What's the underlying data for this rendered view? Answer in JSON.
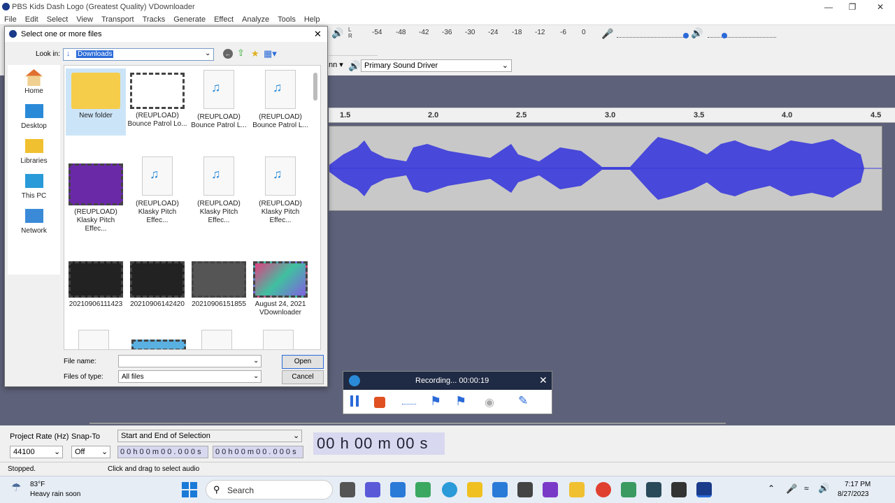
{
  "window": {
    "title": "PBS Kids Dash Logo (Greatest Quality) VDownloader"
  },
  "menu": [
    "File",
    "Edit",
    "Select",
    "View",
    "Transport",
    "Tracks",
    "Generate",
    "Effect",
    "Analyze",
    "Tools",
    "Help"
  ],
  "meter": {
    "ticks": [
      "-54",
      "-48",
      "-42",
      "-36",
      "-30",
      "-24",
      "-18",
      "-12",
      "-6",
      "0"
    ],
    "lr": "L\nR"
  },
  "device": {
    "host_partial": "nn",
    "output": "Primary Sound Driver"
  },
  "ruler": {
    "ticks": [
      "1.5",
      "2.0",
      "2.5",
      "3.0",
      "3.5",
      "4.0",
      "4.5"
    ]
  },
  "dialog": {
    "title": "Select one or more files",
    "look_in_label": "Look in:",
    "look_in_value": "Downloads",
    "places": [
      "Home",
      "Desktop",
      "Libraries",
      "This PC",
      "Network"
    ],
    "files": [
      {
        "line1": "New folder",
        "line2": "",
        "kind": "folder"
      },
      {
        "line1": "(REUPLOAD)",
        "line2": "Bounce Patrol Lo...",
        "kind": "video"
      },
      {
        "line1": "(REUPLOAD)",
        "line2": "Bounce Patrol L...",
        "kind": "media"
      },
      {
        "line1": "(REUPLOAD)",
        "line2": "Bounce Patrol L...",
        "kind": "media"
      },
      {
        "line1": "(REUPLOAD)",
        "line2": "Klasky Pitch Effec...",
        "kind": "video"
      },
      {
        "line1": "(REUPLOAD)",
        "line2": "Klasky Pitch Effec...",
        "kind": "media"
      },
      {
        "line1": "(REUPLOAD)",
        "line2": "Klasky Pitch Effec...",
        "kind": "media"
      },
      {
        "line1": "(REUPLOAD)",
        "line2": "Klasky Pitch Effec...",
        "kind": "media"
      },
      {
        "line1": "20210906111423",
        "line2": "",
        "kind": "video"
      },
      {
        "line1": "20210906142420",
        "line2": "",
        "kind": "video"
      },
      {
        "line1": "20210906151855",
        "line2": "",
        "kind": "video"
      },
      {
        "line1": "August 24, 2021",
        "line2": "VDownloader",
        "kind": "video"
      }
    ],
    "file_name_label": "File name:",
    "file_name_value": "",
    "files_of_type_label": "Files of type:",
    "files_of_type_value": "All files",
    "open_label": "Open",
    "cancel_label": "Cancel"
  },
  "recorder": {
    "status": "Recording... 00:00:19"
  },
  "bottom": {
    "project_rate_label": "Project Rate (Hz)",
    "project_rate_value": "44100",
    "snap_label": "Snap-To",
    "snap_value": "Off",
    "selection_mode": "Start and End of Selection",
    "sel_start": "0 0 h 0 0 m 0 0 . 0 0 0 s",
    "sel_end": "0 0 h 0 0 m 0 0 . 0 0 0 s",
    "big_time": "00 h 00 m 00 s"
  },
  "status": {
    "left": "Stopped.",
    "hint": "Click and drag to select audio"
  },
  "taskbar": {
    "temp": "83°F",
    "weather": "Heavy rain soon",
    "search": "Search",
    "time": "7:17 PM",
    "date": "8/27/2023"
  },
  "colors": {
    "waveform": "#3a3adb",
    "background": "#5d6179",
    "recorder_head": "#1f2a44"
  }
}
